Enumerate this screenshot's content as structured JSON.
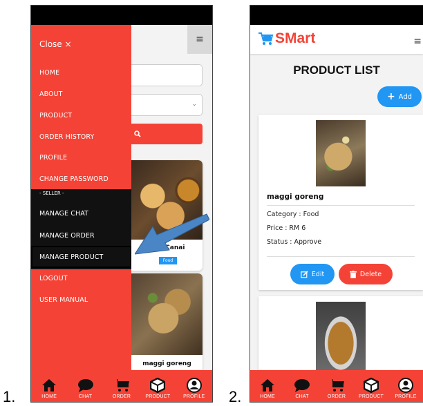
{
  "steps": {
    "one": "1.",
    "two": "2."
  },
  "phone1": {
    "drawer": {
      "close_label": "Close ×",
      "items": [
        "HOME",
        "ABOUT",
        "PRODUCT",
        "ORDER HISTORY",
        "PROFILE",
        "CHANGE PASSWORD"
      ],
      "seller_label": "- SELLER -",
      "seller_items": [
        "MANAGE CHAT",
        "MANAGE ORDER",
        "MANAGE PRODUCT"
      ],
      "bottom_items": [
        "LOGOUT",
        "USER MANUAL"
      ]
    },
    "background": {
      "cards": [
        {
          "name": "Roti Canai",
          "badge": "Food"
        },
        {
          "name": "maggi goreng"
        }
      ]
    }
  },
  "phone2": {
    "logo": "SMart",
    "title": "PRODUCT LIST",
    "add_label": "Add",
    "product": {
      "name": "maggi goreng",
      "category": "Category : Food",
      "price": "Price : RM 6",
      "status": "Status : Approve",
      "edit_label": "Edit",
      "delete_label": "Delete"
    }
  },
  "bottomnav": [
    "HOME",
    "CHAT",
    "ORDER",
    "PRODUCT",
    "PROFILE"
  ],
  "colors": {
    "primary_red": "#f44336",
    "primary_blue": "#2196f3",
    "arrow_blue": "#4a86c5"
  },
  "icons": [
    "home-icon",
    "chat-icon",
    "cart-icon",
    "box-icon",
    "profile-icon",
    "search-icon",
    "plus-icon",
    "edit-icon",
    "trash-icon",
    "hamburger-icon",
    "cart-logo-icon"
  ]
}
